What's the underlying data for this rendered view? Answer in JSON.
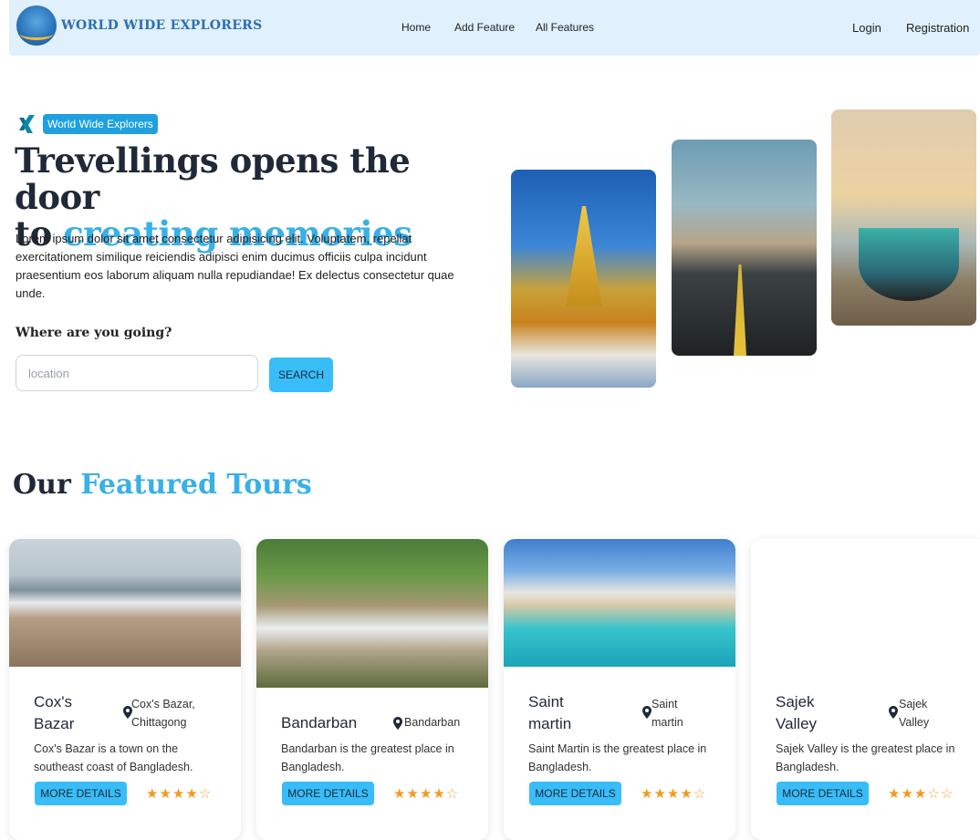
{
  "nav": {
    "brand": "WORLD WIDE EXPLORERS",
    "links": [
      "Home",
      "Add Feature",
      "All Features"
    ],
    "login": "Login",
    "register": "Registration"
  },
  "hero": {
    "badge": "World Wide Explorers",
    "title_line1": "Trevellings opens the door",
    "title_line2_prefix": "to ",
    "title_line2_accent": "creating memories",
    "paragraph": "Lorem ipsum dolor sit amet consectetur adipisicing elit. Voluptatem, repellat exercitationem similique reiciendis adipisci enim ducimus officiis culpa incidunt praesentium eos laborum aliquam nulla repudiandae! Ex delectus consectetur quae unde.",
    "where_label": "Where are you going?",
    "search_placeholder": "location",
    "search_button": "SEARCH"
  },
  "featured": {
    "title_prefix": "Our ",
    "title_accent": "Featured Tours",
    "cards": [
      {
        "name": "Cox's Bazar",
        "location": "Cox's Bazar, Chittagong",
        "description": "Cox's Bazar is a town on the southeast coast of Bangladesh.",
        "button": "MORE DETAILS",
        "rating": 4
      },
      {
        "name": "Bandarban",
        "location": "Bandarban",
        "description": "Bandarban is the greatest place in Bangladesh.",
        "button": "MORE DETAILS",
        "rating": 4
      },
      {
        "name": "Saint martin",
        "location": "Saint martin",
        "description": "Saint Martin is the greatest place in Bangladesh.",
        "button": "MORE DETAILS",
        "rating": 4
      },
      {
        "name": "Sajek Valley",
        "location": "Sajek Valley",
        "description": "Sajek Valley is the greatest place in Bangladesh.",
        "button": "MORE DETAILS",
        "rating": 3
      }
    ]
  },
  "colors": {
    "accent": "#38b0e8",
    "button": "#38bdf8",
    "nav_bg": "#e0f0fc",
    "star": "#f39a1e"
  }
}
